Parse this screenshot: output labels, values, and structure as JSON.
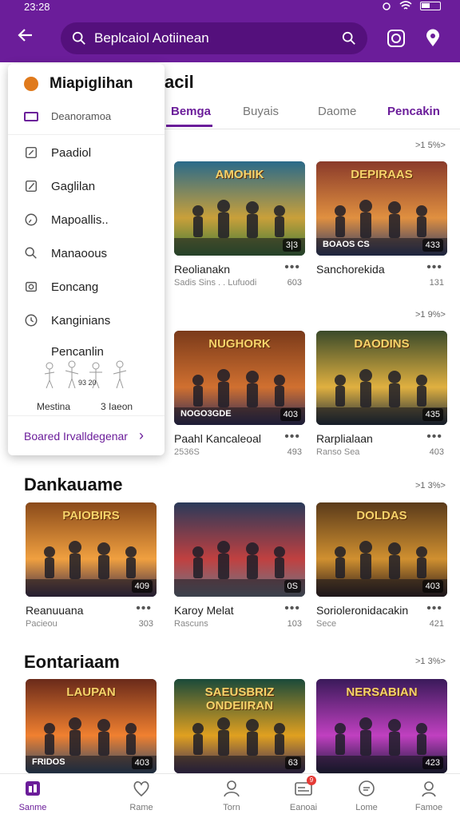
{
  "status": {
    "time": "23:28"
  },
  "search": {
    "value": "Beplcaiol Aotiinean"
  },
  "sections": {
    "first_title_partial": "acil",
    "tabs": [
      "Bemga",
      "Buyais",
      "Daome",
      "Pencakin"
    ],
    "more_1": ">1 5%>",
    "more_2": ">1 9%>",
    "section2_title": "Dankauame",
    "more_3": ">1 3%>",
    "section3_title": "Eontariaam",
    "more_4": ">1 3%>"
  },
  "cards": [
    {
      "title": "Reolianakn",
      "sub": "Sadis Sins . . Lufuodi",
      "badge": "3|3",
      "count": "603"
    },
    {
      "title": "Sanchorekida",
      "sub": "",
      "badge": "433",
      "count": "131"
    },
    {
      "title": "Paahl Kancaleoal",
      "sub": "2536S",
      "badge": "403",
      "count": "493"
    },
    {
      "title": "Rarplialaan",
      "sub": "Ranso    Sea",
      "badge": "435",
      "count": "403"
    },
    {
      "title": "Reanuuana",
      "sub": "Pacieou",
      "badge": "409",
      "count": "303"
    },
    {
      "title": "Karoy Melat",
      "sub": "Rascuns",
      "badge": "0S",
      "count": "103"
    },
    {
      "title": "Sorioleronidacakin",
      "sub": "Sece",
      "badge": "403",
      "count": "421"
    },
    {
      "title": "",
      "sub": "",
      "badge": "403",
      "count": ""
    },
    {
      "title": "",
      "sub": "",
      "badge": "63",
      "count": ""
    },
    {
      "title": "",
      "sub": "",
      "badge": "423",
      "count": ""
    }
  ],
  "thumb_texts": [
    "AMOHIK",
    "DEPIRAAS",
    "NUGHORK",
    "DAODINS",
    "PAIOBIRS",
    "",
    "DOLDAS",
    "LAUPAN",
    "SAEUSBRIZ ONDEIIRAN",
    "NERSABIAN"
  ],
  "thumb_subtexts": [
    "",
    "BOAOS CS",
    "NOGO3GDE",
    "",
    "",
    "",
    "",
    "FRIDOS",
    "",
    ""
  ],
  "menu": {
    "head": "Miapiglihan",
    "sub": "Deanoramoa",
    "items": [
      "Paadiol",
      "Gaglilan",
      "Mapoallis..",
      "Manaoous",
      "Eoncang",
      "Kanginians",
      "Pencanlin"
    ],
    "art_caption": "93 20",
    "cap_left": "Mestina",
    "cap_right": "3 Iaeon",
    "footer": "Boared Irvalldegenar"
  },
  "bottom_nav": [
    {
      "label": "Sanme",
      "icon": "home-icon",
      "active": true
    },
    {
      "label": "Rame",
      "icon": "heart-icon",
      "active": false
    },
    {
      "label": "Torn",
      "icon": "person-icon",
      "active": false
    },
    {
      "label": "Eanoai",
      "icon": "card-icon",
      "active": false,
      "notif": "9"
    },
    {
      "label": "Lome",
      "icon": "chat-icon",
      "active": false
    },
    {
      "label": "Famoe",
      "icon": "profile-icon",
      "active": false
    }
  ],
  "colors": {
    "brand": "#6b1d9a",
    "search_bg": "#54107c",
    "menu_dot": "#e07a1c"
  }
}
